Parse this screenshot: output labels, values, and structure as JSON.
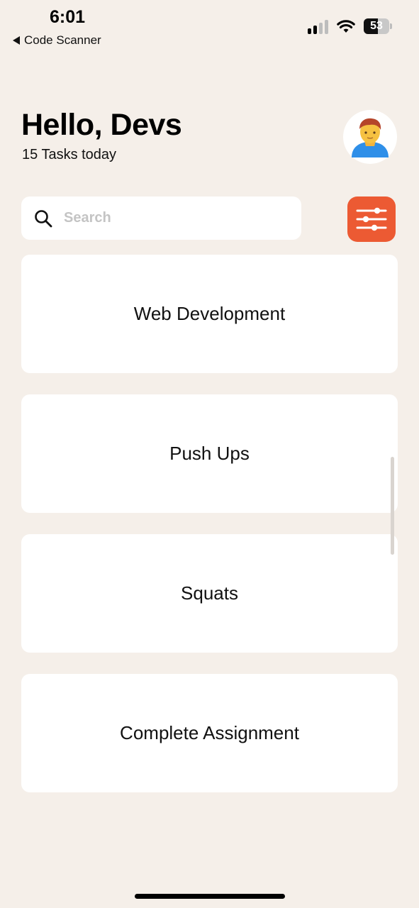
{
  "status_bar": {
    "time": "6:01",
    "back_app": "Code Scanner",
    "battery": "53",
    "icons": [
      "back-triangle-icon",
      "cellular-signal-icon",
      "wifi-icon",
      "battery-icon"
    ]
  },
  "header": {
    "greeting": "Hello, Devs",
    "subtitle": "15 Tasks today",
    "avatar_icon": "person-avatar-icon"
  },
  "search": {
    "placeholder": "Search",
    "value": "",
    "icon": "search-icon"
  },
  "filter_button": {
    "icon": "sliders-icon",
    "color": "#ec5a33"
  },
  "tasks": [
    {
      "title": "Web Development"
    },
    {
      "title": "Push Ups"
    },
    {
      "title": "Squats"
    },
    {
      "title": "Complete Assignment"
    }
  ],
  "colors": {
    "background": "#f5efe9",
    "card": "#ffffff",
    "accent": "#ec5a33"
  }
}
